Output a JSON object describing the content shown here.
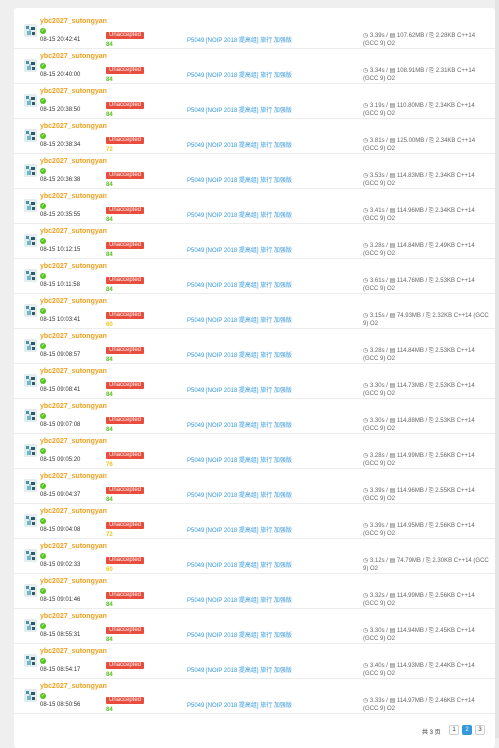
{
  "records": [
    {
      "user": "ybc2027_sutongyan",
      "time": "08-15 20:42:41",
      "status": "Unaccepted",
      "score": "84",
      "problem": "P5049 [NOIP 2018 提高组] 旅行 加强版",
      "meta": "◷ 3.39s / ▤ 107.62MB / ⎘ 2.28KB C++14 (GCC 9) O2"
    },
    {
      "user": "ybc2027_sutongyan",
      "time": "08-15 20:40:00",
      "status": "Unaccepted",
      "score": "84",
      "problem": "P5049 [NOIP 2018 提高组] 旅行 加强版",
      "meta": "◷ 3.34s / ▤ 108.91MB / ⎘ 2.31KB C++14 (GCC 9) O2"
    },
    {
      "user": "ybc2027_sutongyan",
      "time": "08-15 20:38:50",
      "status": "Unaccepted",
      "score": "84",
      "problem": "P5049 [NOIP 2018 提高组] 旅行 加强版",
      "meta": "◷ 3.19s / ▤ 110.80MB / ⎘ 2.34KB C++14 (GCC 9) O2"
    },
    {
      "user": "ybc2027_sutongyan",
      "time": "08-15 20:38:34",
      "status": "Unaccepted",
      "score": "72",
      "problem": "P5049 [NOIP 2018 提高组] 旅行 加强版",
      "meta": "◷ 3.81s / ▤ 125.00MB / ⎘ 2.34KB C++14 (GCC 9) O2"
    },
    {
      "user": "ybc2027_sutongyan",
      "time": "08-15 20:36:38",
      "status": "Unaccepted",
      "score": "84",
      "problem": "P5049 [NOIP 2018 提高组] 旅行 加强版",
      "meta": "◷ 3.53s / ▤ 114.83MB / ⎘ 2.34KB C++14 (GCC 9) O2"
    },
    {
      "user": "ybc2027_sutongyan",
      "time": "08-15 20:35:55",
      "status": "Unaccepted",
      "score": "84",
      "problem": "P5049 [NOIP 2018 提高组] 旅行 加强版",
      "meta": "◷ 3.41s / ▤ 114.96MB / ⎘ 2.34KB C++14 (GCC 9) O2"
    },
    {
      "user": "ybc2027_sutongyan",
      "time": "08-15 10:12:15",
      "status": "Unaccepted",
      "score": "84",
      "problem": "P5049 [NOIP 2018 提高组] 旅行 加强版",
      "meta": "◷ 3.28s / ▤ 114.84MB / ⎘ 2.49KB C++14 (GCC 9) O2"
    },
    {
      "user": "ybc2027_sutongyan",
      "time": "08-15 10:11:58",
      "status": "Unaccepted",
      "score": "84",
      "problem": "P5049 [NOIP 2018 提高组] 旅行 加强版",
      "meta": "◷ 3.61s / ▤ 114.76MB / ⎘ 2.53KB C++14 (GCC 9) O2"
    },
    {
      "user": "ybc2027_sutongyan",
      "time": "08-15 10:03:41",
      "status": "Unaccepted",
      "score": "60",
      "problem": "P5049 [NOIP 2018 提高组] 旅行 加强版",
      "meta": "◷ 3.15s / ▤ 74.93MB / ⎘ 2.32KB C++14 (GCC 9) O2"
    },
    {
      "user": "ybc2027_sutongyan",
      "time": "08-15 09:08:57",
      "status": "Unaccepted",
      "score": "84",
      "problem": "P5049 [NOIP 2018 提高组] 旅行 加强版",
      "meta": "◷ 3.28s / ▤ 114.84MB / ⎘ 2.53KB C++14 (GCC 9) O2"
    },
    {
      "user": "ybc2027_sutongyan",
      "time": "08-15 09:08:41",
      "status": "Unaccepted",
      "score": "84",
      "problem": "P5049 [NOIP 2018 提高组] 旅行 加强版",
      "meta": "◷ 3.30s / ▤ 114.73MB / ⎘ 2.53KB C++14 (GCC 9) O2"
    },
    {
      "user": "ybc2027_sutongyan",
      "time": "08-15 09:07:08",
      "status": "Unaccepted",
      "score": "84",
      "problem": "P5049 [NOIP 2018 提高组] 旅行 加强版",
      "meta": "◷ 3.30s / ▤ 114.88MB / ⎘ 2.53KB C++14 (GCC 9) O2"
    },
    {
      "user": "ybc2027_sutongyan",
      "time": "08-15 09:05:20",
      "status": "Unaccepted",
      "score": "76",
      "problem": "P5049 [NOIP 2018 提高组] 旅行 加强版",
      "meta": "◷ 3.28s / ▤ 114.99MB / ⎘ 2.56KB C++14 (GCC 9) O2"
    },
    {
      "user": "ybc2027_sutongyan",
      "time": "08-15 09:04:37",
      "status": "Unaccepted",
      "score": "84",
      "problem": "P5049 [NOIP 2018 提高组] 旅行 加强版",
      "meta": "◷ 3.39s / ▤ 114.96MB / ⎘ 2.55KB C++14 (GCC 9) O2"
    },
    {
      "user": "ybc2027_sutongyan",
      "time": "08-15 09:04:08",
      "status": "Unaccepted",
      "score": "72",
      "problem": "P5049 [NOIP 2018 提高组] 旅行 加强版",
      "meta": "◷ 3.39s / ▤ 114.95MB / ⎘ 2.56KB C++14 (GCC 9) O2"
    },
    {
      "user": "ybc2027_sutongyan",
      "time": "08-15 09:02:33",
      "status": "Unaccepted",
      "score": "60",
      "problem": "P5049 [NOIP 2018 提高组] 旅行 加强版",
      "meta": "◷ 3.12s / ▤ 74.79MB / ⎘ 2.30KB C++14 (GCC 9) O2"
    },
    {
      "user": "ybc2027_sutongyan",
      "time": "08-15 09:01:46",
      "status": "Unaccepted",
      "score": "84",
      "problem": "P5049 [NOIP 2018 提高组] 旅行 加强版",
      "meta": "◷ 3.32s / ▤ 114.99MB / ⎘ 2.56KB C++14 (GCC 9) O2"
    },
    {
      "user": "ybc2027_sutongyan",
      "time": "08-15 08:55:31",
      "status": "Unaccepted",
      "score": "84",
      "problem": "P5049 [NOIP 2018 提高组] 旅行 加强版",
      "meta": "◷ 3.30s / ▤ 114.94MB / ⎘ 2.45KB C++14 (GCC 9) O2"
    },
    {
      "user": "ybc2027_sutongyan",
      "time": "08-15 08:54:17",
      "status": "Unaccepted",
      "score": "84",
      "problem": "P5049 [NOIP 2018 提高组] 旅行 加强版",
      "meta": "◷ 3.40s / ▤ 114.93MB / ⎘ 2.44KB C++14 (GCC 9) O2"
    },
    {
      "user": "ybc2027_sutongyan",
      "time": "08-15 08:50:56",
      "status": "Unaccepted",
      "score": "84",
      "problem": "P5049 [NOIP 2018 提高组] 旅行 加强版",
      "meta": "◷ 3.33s / ▤ 114.97MB / ⎘ 2.46KB C++14 (GCC 9) O2"
    }
  ],
  "pagination": {
    "total_label": "共 3 页",
    "pages": [
      "1",
      "2",
      "3"
    ],
    "current": "2"
  },
  "colors": {
    "username": "#f0a01e",
    "status_badge": "#e74c3c",
    "problem_link": "#3498db",
    "check": "#52c41a",
    "score_84": "#52c41a",
    "score_other": "#f0c419",
    "page_active": "#3498db"
  },
  "icons": {
    "status": "check-circle-icon",
    "time": "clock-icon",
    "memory": "memory-icon",
    "code_size": "file-size-icon"
  }
}
